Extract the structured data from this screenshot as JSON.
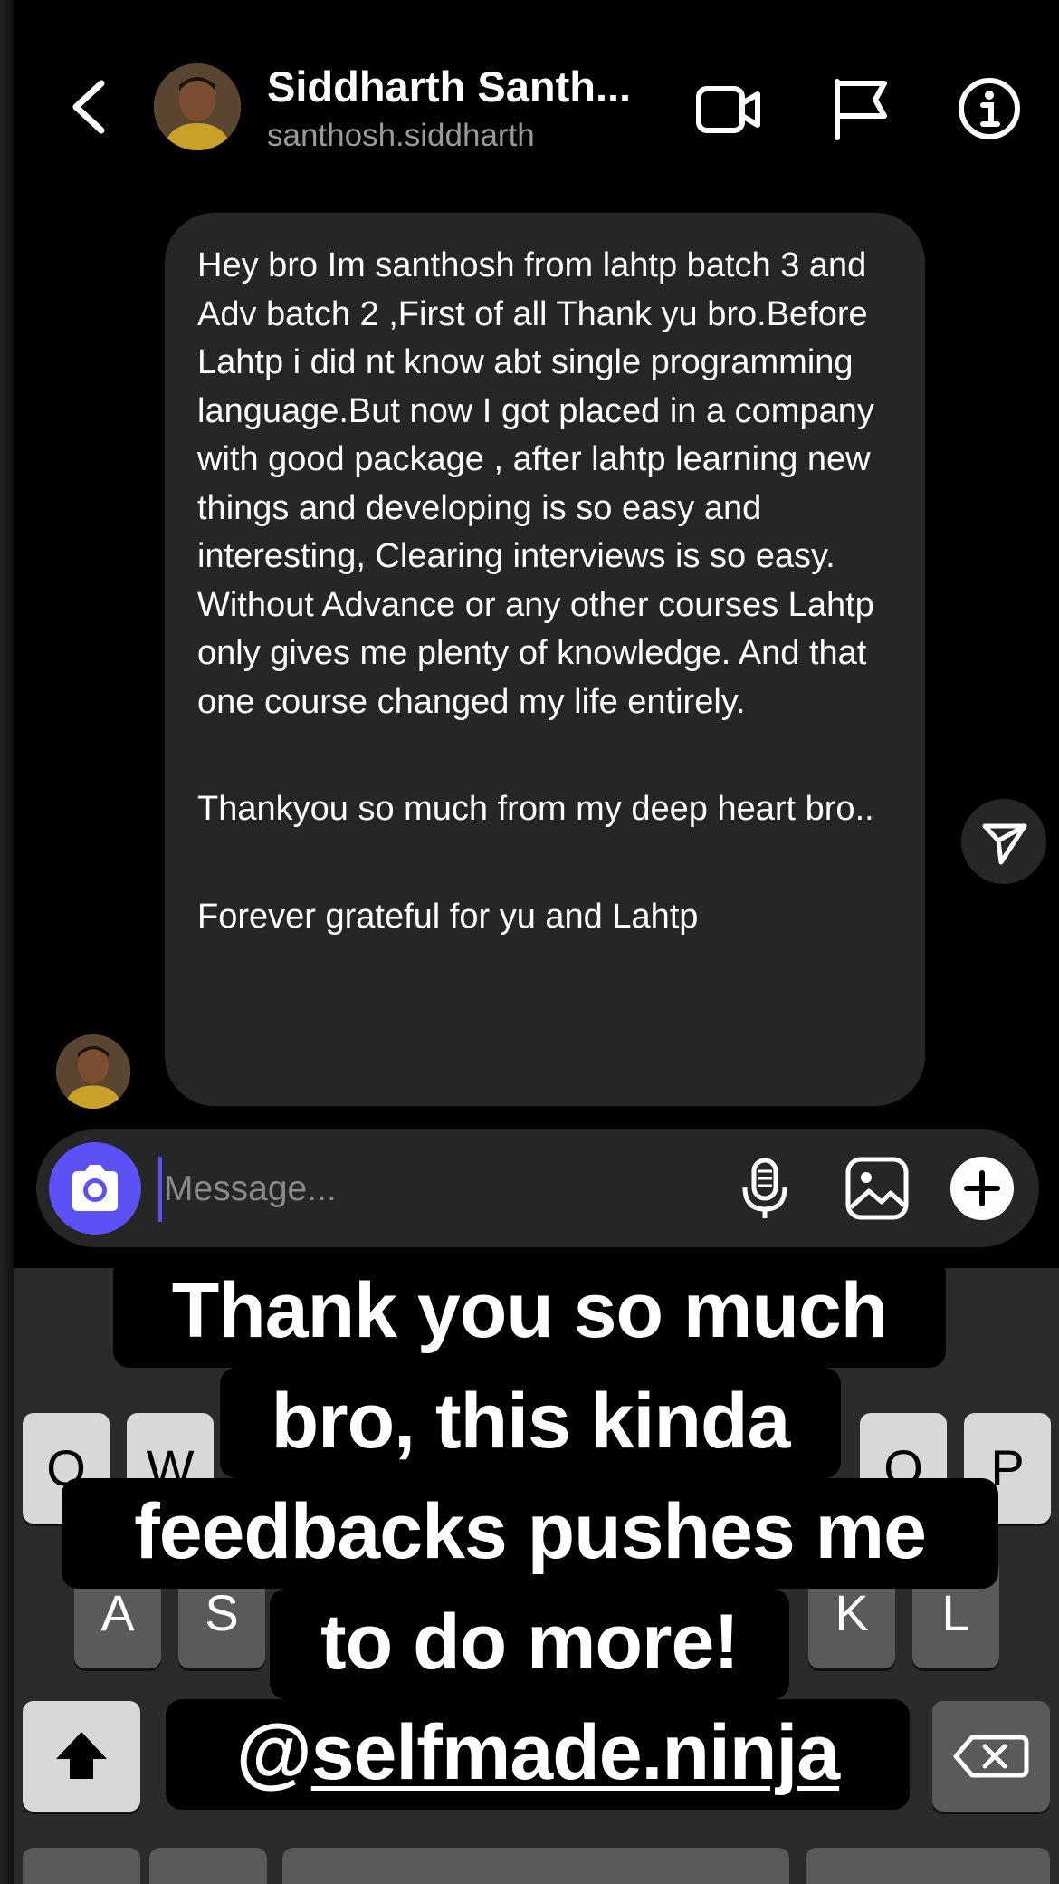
{
  "header": {
    "display_name": "Siddharth Santh...",
    "username": "santhosh.siddharth"
  },
  "message": {
    "paragraph1": "Hey bro Im santhosh from lahtp batch 3 and Adv batch 2 ,First of all Thank yu bro.Before Lahtp i did nt know abt single programming language.But now I got placed in a company with good package , after lahtp learning new things and developing is so easy and interesting, Clearing interviews is so easy. Without Advance or any other courses Lahtp only gives me plenty of knowledge. And that one course changed my life entirely.",
    "paragraph2": "Thankyou so much from my deep heart bro..",
    "paragraph3": "Forever grateful for yu and Lahtp"
  },
  "composer": {
    "placeholder": "Message..."
  },
  "keyboard": {
    "keys": {
      "q": "Q",
      "w": "W",
      "o": "O",
      "p": "P",
      "a": "A",
      "s": "S",
      "k": "K",
      "l": "L"
    }
  },
  "caption": {
    "line1": "Thank you so much",
    "line2": "bro, this kinda",
    "line3": "feedbacks pushes me",
    "line4": "to do more!",
    "mention_at": "@",
    "mention_handle": "selfmade.ninja"
  },
  "colors": {
    "accent": "#5b51f5",
    "bubble": "#262626",
    "background": "#000000"
  },
  "icons": {
    "back": "chevron-left-icon",
    "video": "video-camera-icon",
    "flag": "flag-icon",
    "info": "info-icon",
    "share": "send-icon",
    "camera": "camera-icon",
    "mic": "microphone-icon",
    "gallery": "image-icon",
    "plus": "plus-icon",
    "shift": "shift-icon",
    "delete": "backspace-icon"
  }
}
